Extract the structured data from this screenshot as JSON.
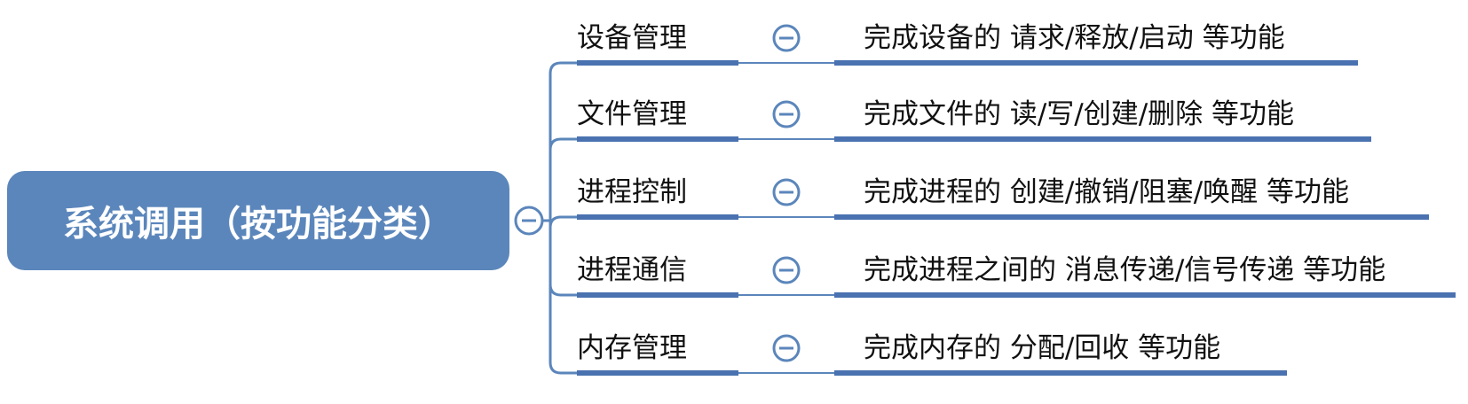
{
  "root": {
    "label": "系统调用（按功能分类）"
  },
  "branches": [
    {
      "label": "设备管理",
      "desc": "完成设备的 请求/释放/启动 等功能"
    },
    {
      "label": "文件管理",
      "desc": "完成文件的 读/写/创建/删除 等功能"
    },
    {
      "label": "进程控制",
      "desc": "完成进程的 创建/撤销/阻塞/唤醒 等功能"
    },
    {
      "label": "进程通信",
      "desc": "完成进程之间的 消息传递/信号传递 等功能"
    },
    {
      "label": "内存管理",
      "desc": "完成内存的 分配/回收 等功能"
    }
  ],
  "colors": {
    "root_fill": "#5b86bb",
    "connector": "#5b86bb",
    "underline": "#4a72b0",
    "icon_stroke": "#5b86bb"
  },
  "icons": {
    "collapse": "minus-circle-icon"
  }
}
